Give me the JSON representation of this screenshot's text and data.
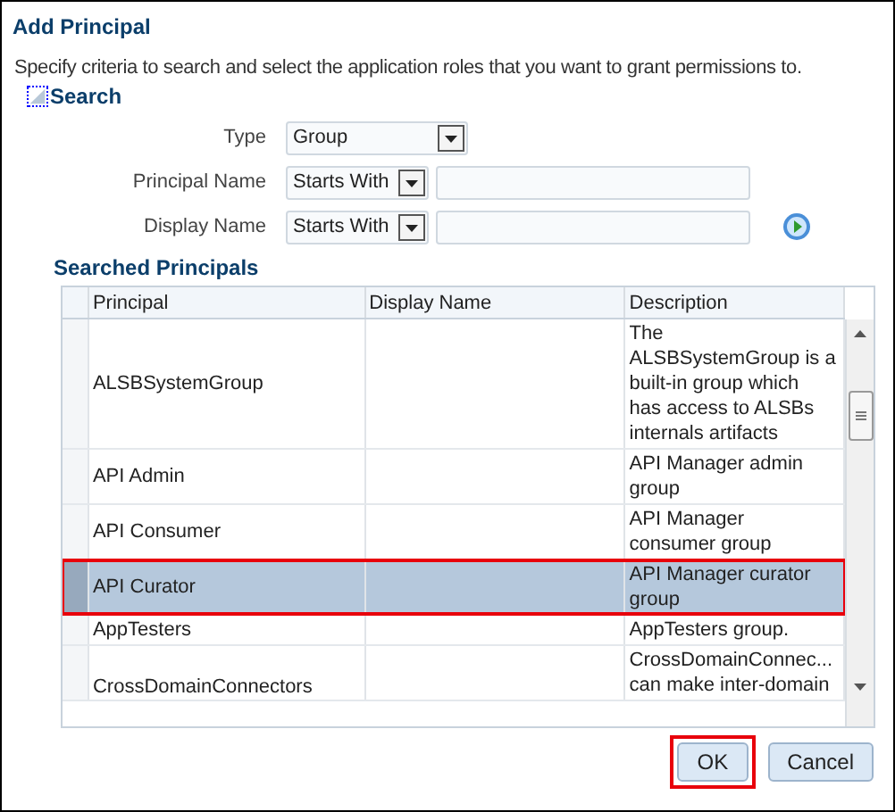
{
  "dialog": {
    "title": "Add Principal",
    "instructions": "Specify criteria to search and select the application roles that you want to grant permissions to."
  },
  "search": {
    "heading": "Search",
    "expanded": true,
    "fields": [
      {
        "label": "Type",
        "operator": "Group"
      },
      {
        "label": "Principal Name",
        "operator": "Starts With"
      },
      {
        "label": "Display Name",
        "operator": "Starts With"
      }
    ]
  },
  "results": {
    "heading": "Searched Principals",
    "columns": [
      "Principal",
      "Display Name",
      "Description"
    ],
    "rows": [
      {
        "principal": "ALSBSystemGroup",
        "description": [
          "The",
          "ALSBSystemGroup is a",
          "built-in group which",
          "has access to ALSBs",
          "internals artifacts"
        ],
        "selected": false,
        "annotated": false
      },
      {
        "principal": "API Admin",
        "description": [
          "API Manager admin",
          "group"
        ],
        "selected": false,
        "annotated": false
      },
      {
        "principal": "API Consumer",
        "description": [
          "API Manager",
          "consumer group"
        ],
        "selected": false,
        "annotated": false
      },
      {
        "principal": "API Curator",
        "description": [
          "API Manager curator",
          "group"
        ],
        "selected": true,
        "annotated": true
      },
      {
        "principal": "AppTesters",
        "description": [
          "AppTesters group."
        ],
        "selected": false,
        "annotated": false
      },
      {
        "principal": "CrossDomainConnectors",
        "description": [
          "CrossDomainConnec...",
          "can make inter-domain"
        ],
        "selected": false,
        "annotated": false
      }
    ]
  },
  "buttons": [
    {
      "label": "OK",
      "annotated": true
    },
    {
      "label": "Cancel",
      "annotated": false
    }
  ]
}
